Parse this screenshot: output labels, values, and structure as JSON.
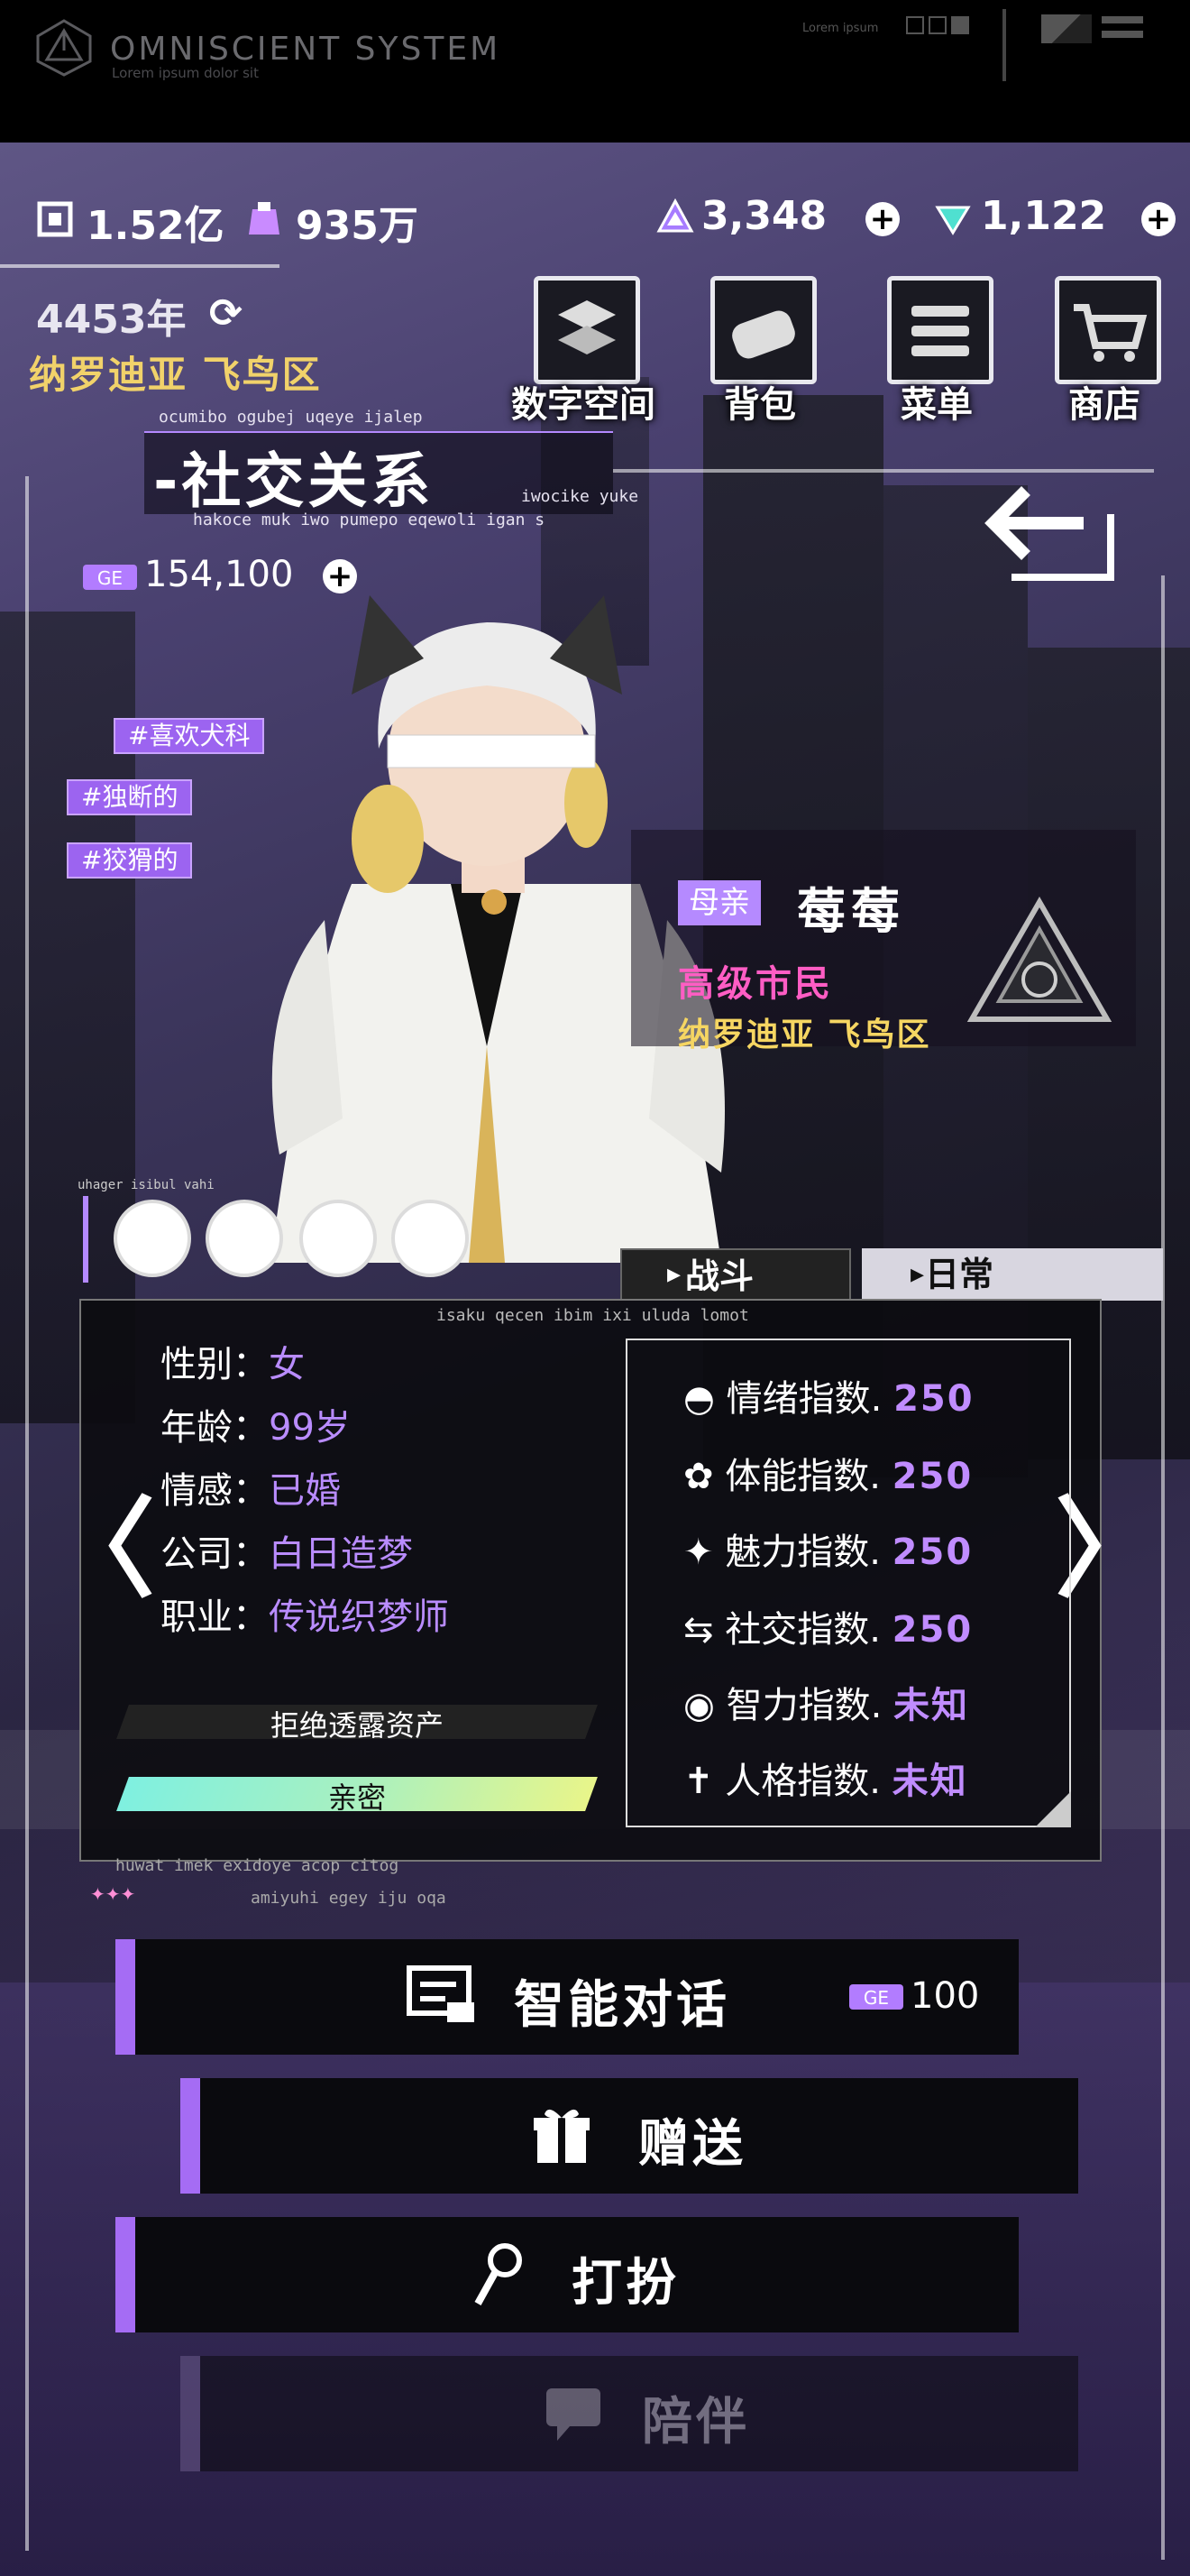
{
  "brand": {
    "title": "OMNISCIENT SYSTEM",
    "subtitle": "Lorem ipsum dolor sit",
    "mini_text": "Lorem ipsum"
  },
  "currency": [
    {
      "icon": "chip-icon",
      "value": "1.52亿"
    },
    {
      "icon": "coin-bag-icon",
      "value": "935万"
    },
    {
      "icon": "crystal-icon",
      "value": "3,348"
    },
    {
      "icon": "gem-icon",
      "value": "1,122"
    }
  ],
  "world": {
    "year": "4453年",
    "location": "纳罗迪亚  飞鸟区"
  },
  "nav": [
    {
      "label": "数字空间",
      "icon": "digital-space-icon"
    },
    {
      "label": "背包",
      "icon": "bag-icon"
    },
    {
      "label": "菜单",
      "icon": "menu-icon"
    },
    {
      "label": "商店",
      "icon": "shop-icon"
    }
  ],
  "page": {
    "title": "-社交关系",
    "caption_top": "ocumibo ogubej uqeye ijalep",
    "caption_bottom": "hakoce muk iwo pumepo eqewoli igan s",
    "caption_side": "iwocike yuke"
  },
  "affection": {
    "value": "154,100"
  },
  "tags": [
    "#喜欢犬科",
    "#独断的",
    "#狡猾的"
  ],
  "character": {
    "relation": "母亲",
    "name": "莓莓",
    "rank": "高级市民",
    "location": "纳罗迪亚 飞鸟区"
  },
  "skills_caption": "uhager isibul vahi",
  "skills": [
    "wolf-icon",
    "dragon-icon",
    "beast-icon",
    "star-icon"
  ],
  "tabs": [
    {
      "label": "战斗"
    },
    {
      "label": "日常"
    }
  ],
  "panel_caption": "isaku qecen ibim ixi uluda lomot",
  "profile": [
    {
      "key": "性别：",
      "value": "女"
    },
    {
      "key": "年龄：",
      "value": "99岁"
    },
    {
      "key": "情感：",
      "value": "已婚"
    },
    {
      "key": "公司：",
      "value": "白日造梦"
    },
    {
      "key": "职业：",
      "value": "传说织梦师"
    }
  ],
  "asset_label": "拒绝透露资产",
  "relationship": {
    "label": "亲密",
    "fill": 1.0
  },
  "stats": [
    {
      "icon": "mood-icon",
      "label": "情绪指数.",
      "value": "250"
    },
    {
      "icon": "stamina-icon",
      "label": "体能指数.",
      "value": "250"
    },
    {
      "icon": "charm-icon",
      "label": "魅力指数.",
      "value": "250"
    },
    {
      "icon": "social-icon",
      "label": "社交指数.",
      "value": "250"
    },
    {
      "icon": "intellect-icon",
      "label": "智力指数.",
      "value": "未知"
    },
    {
      "icon": "personality-icon",
      "label": "人格指数.",
      "value": "未知"
    }
  ],
  "panel_footer_1": "huwat imek exidoye acop citog",
  "panel_footer_2": "amiyuhi egey iju oqa",
  "actions": [
    {
      "label": "智能对话",
      "cost": "100"
    },
    {
      "label": "赠送"
    },
    {
      "label": "打扮"
    },
    {
      "label": "陪伴"
    }
  ]
}
